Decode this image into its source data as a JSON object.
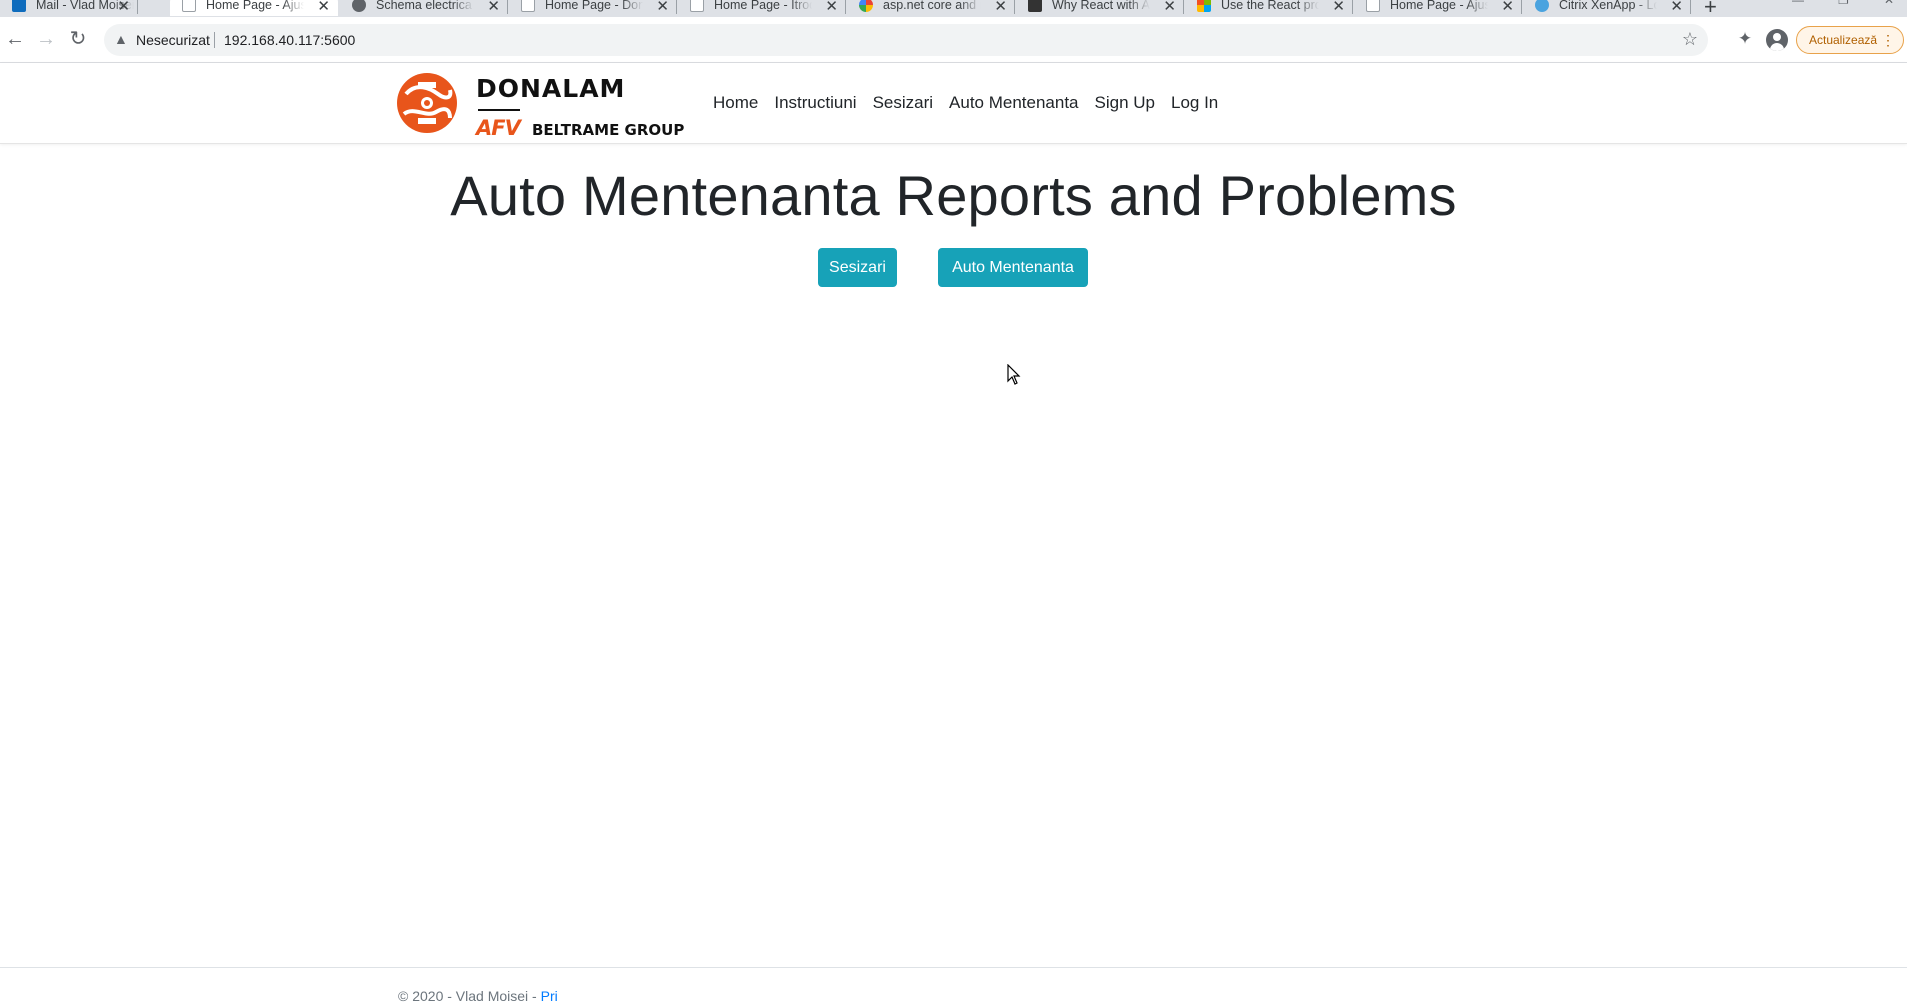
{
  "browser": {
    "tabs": [
      {
        "title": "Mail - Vlad Moisei -",
        "favicon": "outlook-icon",
        "active": false
      },
      {
        "title": "Home Page - Ajust",
        "favicon": "page-icon",
        "active": true
      },
      {
        "title": "Schema electrica - F",
        "favicon": "globe-icon",
        "active": false
      },
      {
        "title": "Home Page - Don_",
        "favicon": "page-icon",
        "active": false
      },
      {
        "title": "Home Page - Itrodu",
        "favicon": "page-icon",
        "active": false
      },
      {
        "title": "asp.net core and re",
        "favicon": "google-icon",
        "active": false
      },
      {
        "title": "Why React with ASP",
        "favicon": "ck-icon",
        "active": false
      },
      {
        "title": "Use the React proje",
        "favicon": "microsoft-icon",
        "active": false
      },
      {
        "title": "Home Page - Ajust",
        "favicon": "page-icon",
        "active": false
      },
      {
        "title": "Citrix XenApp - Log",
        "favicon": "citrix-icon",
        "active": false
      }
    ],
    "security_label": "Nesecurizat",
    "url": "192.168.40.117:5600",
    "update_label": "Actualizează",
    "colors": {
      "tabstrip": "#dee1e6",
      "update_accent": "#e8a24a"
    }
  },
  "site": {
    "brand": {
      "name": "DONALAM",
      "sub_logo": "AFV",
      "group": "BELTRAME GROUP",
      "logo_color": "#e8551b"
    },
    "nav": {
      "items": [
        {
          "label": "Home"
        },
        {
          "label": "Instructiuni"
        },
        {
          "label": "Sesizari"
        },
        {
          "label": "Auto Mentenanta"
        },
        {
          "label": "Sign Up"
        },
        {
          "label": "Log In"
        }
      ]
    },
    "headline": "Auto Mentenanta Reports and Problems",
    "buttons": {
      "sesizari": "Sesizari",
      "auto_mentenanta": "Auto Mentenanta",
      "color": "#17a2b8"
    },
    "footer": {
      "text": "© 2020 - Vlad Moisei - ",
      "link": "Pri"
    }
  }
}
